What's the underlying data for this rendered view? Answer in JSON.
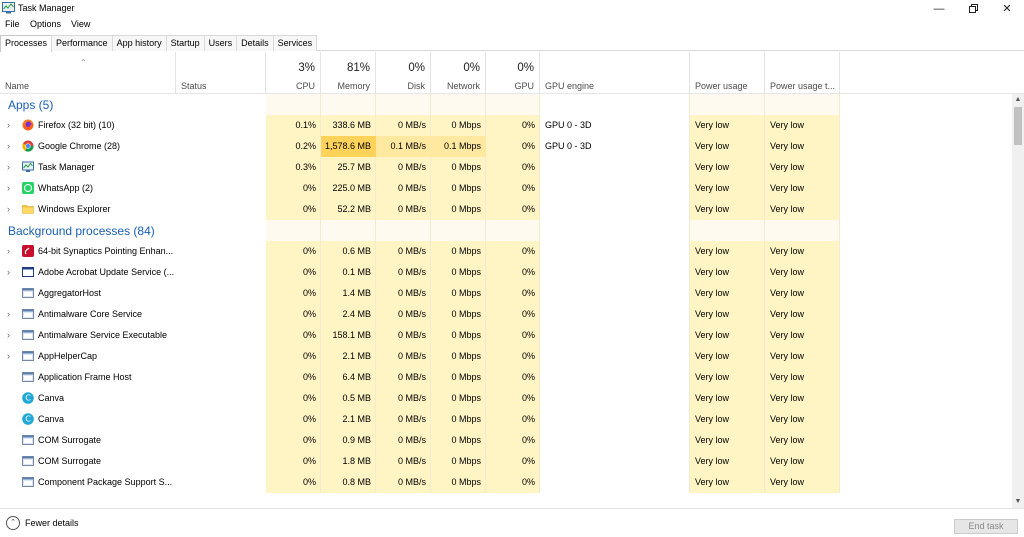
{
  "window": {
    "title": "Task Manager"
  },
  "menu": [
    "File",
    "Options",
    "View"
  ],
  "tabs": [
    "Processes",
    "Performance",
    "App history",
    "Startup",
    "Users",
    "Details",
    "Services"
  ],
  "header": {
    "name": "Name",
    "status": "Status",
    "cpu": {
      "pct": "3%",
      "label": "CPU"
    },
    "memory": {
      "pct": "81%",
      "label": "Memory"
    },
    "disk": {
      "pct": "0%",
      "label": "Disk"
    },
    "network": {
      "pct": "0%",
      "label": "Network"
    },
    "gpu": {
      "pct": "0%",
      "label": "GPU"
    },
    "gpu_engine": "GPU engine",
    "power": "Power usage",
    "power_trend": "Power usage t..."
  },
  "groups": {
    "apps": "Apps (5)",
    "background": "Background processes (84)"
  },
  "apps": [
    {
      "name": "Firefox (32 bit) (10)",
      "icon": "firefox-icon",
      "cpu": "0.1%",
      "mem": "338.6 MB",
      "disk": "0 MB/s",
      "net": "0 Mbps",
      "gpu": "0%",
      "engine": "GPU 0 - 3D",
      "power": "Very low",
      "trend": "Very low",
      "expand": true
    },
    {
      "name": "Google Chrome (28)",
      "icon": "chrome-icon",
      "cpu": "0.2%",
      "mem": "1,578.6 MB",
      "disk": "0.1 MB/s",
      "net": "0.1 Mbps",
      "gpu": "0%",
      "engine": "GPU 0 - 3D",
      "power": "Very low",
      "trend": "Very low",
      "expand": true,
      "highlight": true
    },
    {
      "name": "Task Manager",
      "icon": "task-manager-icon",
      "cpu": "0.3%",
      "mem": "25.7 MB",
      "disk": "0 MB/s",
      "net": "0 Mbps",
      "gpu": "0%",
      "engine": "",
      "power": "Very low",
      "trend": "Very low",
      "expand": true
    },
    {
      "name": "WhatsApp (2)",
      "icon": "whatsapp-icon",
      "cpu": "0%",
      "mem": "225.0 MB",
      "disk": "0 MB/s",
      "net": "0 Mbps",
      "gpu": "0%",
      "engine": "",
      "power": "Very low",
      "trend": "Very low",
      "expand": true
    },
    {
      "name": "Windows Explorer",
      "icon": "folder-icon",
      "cpu": "0%",
      "mem": "52.2 MB",
      "disk": "0 MB/s",
      "net": "0 Mbps",
      "gpu": "0%",
      "engine": "",
      "power": "Very low",
      "trend": "Very low",
      "expand": true
    }
  ],
  "background": [
    {
      "name": "64-bit Synaptics Pointing Enhan...",
      "icon": "synaptics-icon",
      "cpu": "0%",
      "mem": "0.6 MB",
      "disk": "0 MB/s",
      "net": "0 Mbps",
      "gpu": "0%",
      "engine": "",
      "power": "Very low",
      "trend": "Very low",
      "expand": true
    },
    {
      "name": "Adobe Acrobat Update Service (...",
      "icon": "window-icon",
      "cpu": "0%",
      "mem": "0.1 MB",
      "disk": "0 MB/s",
      "net": "0 Mbps",
      "gpu": "0%",
      "engine": "",
      "power": "Very low",
      "trend": "Very low",
      "expand": true
    },
    {
      "name": "AggregatorHost",
      "icon": "app-window-icon",
      "cpu": "0%",
      "mem": "1.4 MB",
      "disk": "0 MB/s",
      "net": "0 Mbps",
      "gpu": "0%",
      "engine": "",
      "power": "Very low",
      "trend": "Very low",
      "expand": false
    },
    {
      "name": "Antimalware Core Service",
      "icon": "app-window-icon",
      "cpu": "0%",
      "mem": "2.4 MB",
      "disk": "0 MB/s",
      "net": "0 Mbps",
      "gpu": "0%",
      "engine": "",
      "power": "Very low",
      "trend": "Very low",
      "expand": true
    },
    {
      "name": "Antimalware Service Executable",
      "icon": "app-window-icon",
      "cpu": "0%",
      "mem": "158.1 MB",
      "disk": "0 MB/s",
      "net": "0 Mbps",
      "gpu": "0%",
      "engine": "",
      "power": "Very low",
      "trend": "Very low",
      "expand": true
    },
    {
      "name": "AppHelperCap",
      "icon": "app-window-icon",
      "cpu": "0%",
      "mem": "2.1 MB",
      "disk": "0 MB/s",
      "net": "0 Mbps",
      "gpu": "0%",
      "engine": "",
      "power": "Very low",
      "trend": "Very low",
      "expand": true
    },
    {
      "name": "Application Frame Host",
      "icon": "app-window-icon",
      "cpu": "0%",
      "mem": "6.4 MB",
      "disk": "0 MB/s",
      "net": "0 Mbps",
      "gpu": "0%",
      "engine": "",
      "power": "Very low",
      "trend": "Very low",
      "expand": false
    },
    {
      "name": "Canva",
      "icon": "canva-icon",
      "cpu": "0%",
      "mem": "0.5 MB",
      "disk": "0 MB/s",
      "net": "0 Mbps",
      "gpu": "0%",
      "engine": "",
      "power": "Very low",
      "trend": "Very low",
      "expand": false
    },
    {
      "name": "Canva",
      "icon": "canva-icon",
      "cpu": "0%",
      "mem": "2.1 MB",
      "disk": "0 MB/s",
      "net": "0 Mbps",
      "gpu": "0%",
      "engine": "",
      "power": "Very low",
      "trend": "Very low",
      "expand": false
    },
    {
      "name": "COM Surrogate",
      "icon": "app-window-icon",
      "cpu": "0%",
      "mem": "0.9 MB",
      "disk": "0 MB/s",
      "net": "0 Mbps",
      "gpu": "0%",
      "engine": "",
      "power": "Very low",
      "trend": "Very low",
      "expand": false
    },
    {
      "name": "COM Surrogate",
      "icon": "app-window-icon",
      "cpu": "0%",
      "mem": "1.8 MB",
      "disk": "0 MB/s",
      "net": "0 Mbps",
      "gpu": "0%",
      "engine": "",
      "power": "Very low",
      "trend": "Very low",
      "expand": false
    },
    {
      "name": "Component Package Support S...",
      "icon": "app-window-icon",
      "cpu": "0%",
      "mem": "0.8 MB",
      "disk": "0 MB/s",
      "net": "0 Mbps",
      "gpu": "0%",
      "engine": "",
      "power": "Very low",
      "trend": "Very low",
      "expand": false
    }
  ],
  "footer": {
    "fewer_details": "Fewer details",
    "end_task": "End task"
  },
  "colors": {
    "heat_light": "#fff4c4",
    "heat_mid": "#ffe9a0",
    "heat_strong": "#ffd25a",
    "group_text": "#1a5fb4"
  }
}
